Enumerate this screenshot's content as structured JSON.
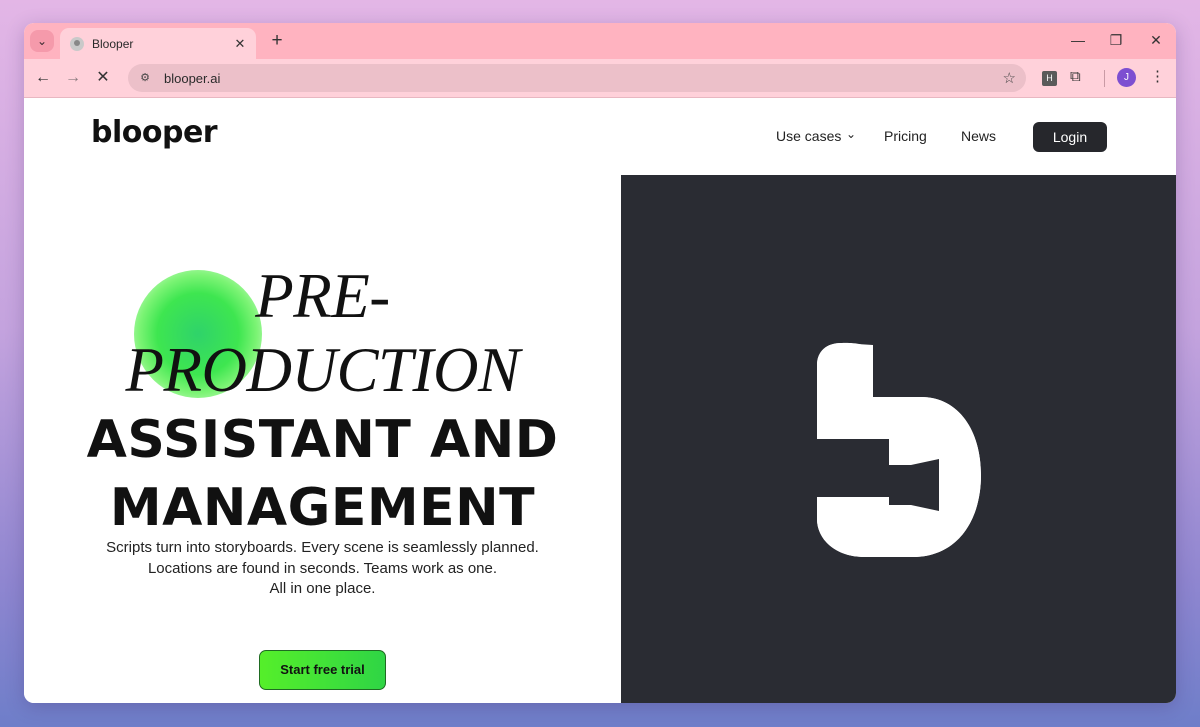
{
  "browser": {
    "tab_title": "Blooper",
    "tab_close": "✕",
    "new_tab": "+",
    "url": "blooper.ai",
    "profile_initial": "J",
    "extension_label": "H"
  },
  "site": {
    "logo": "blooper",
    "nav": {
      "use_cases": "Use cases",
      "pricing": "Pricing",
      "news": "News",
      "login": "Login"
    },
    "hero": {
      "line1": "PRE-",
      "line2": "PRODUCTION",
      "line3": "ASSISTANT AND",
      "line4": "MANAGEMENT",
      "sub1": "Scripts turn into storyboards. Every scene is seamlessly planned.",
      "sub2": "Locations are found in seconds. Teams work as one.",
      "sub3": "All in one place.",
      "cta": "Start free trial"
    }
  },
  "colors": {
    "tabstrip": "#ffb3c0",
    "toolbar": "#ffd1da",
    "hero_dark": "#2a2c33",
    "cta_green": "#55ef2a",
    "login_bg": "#26272c"
  }
}
